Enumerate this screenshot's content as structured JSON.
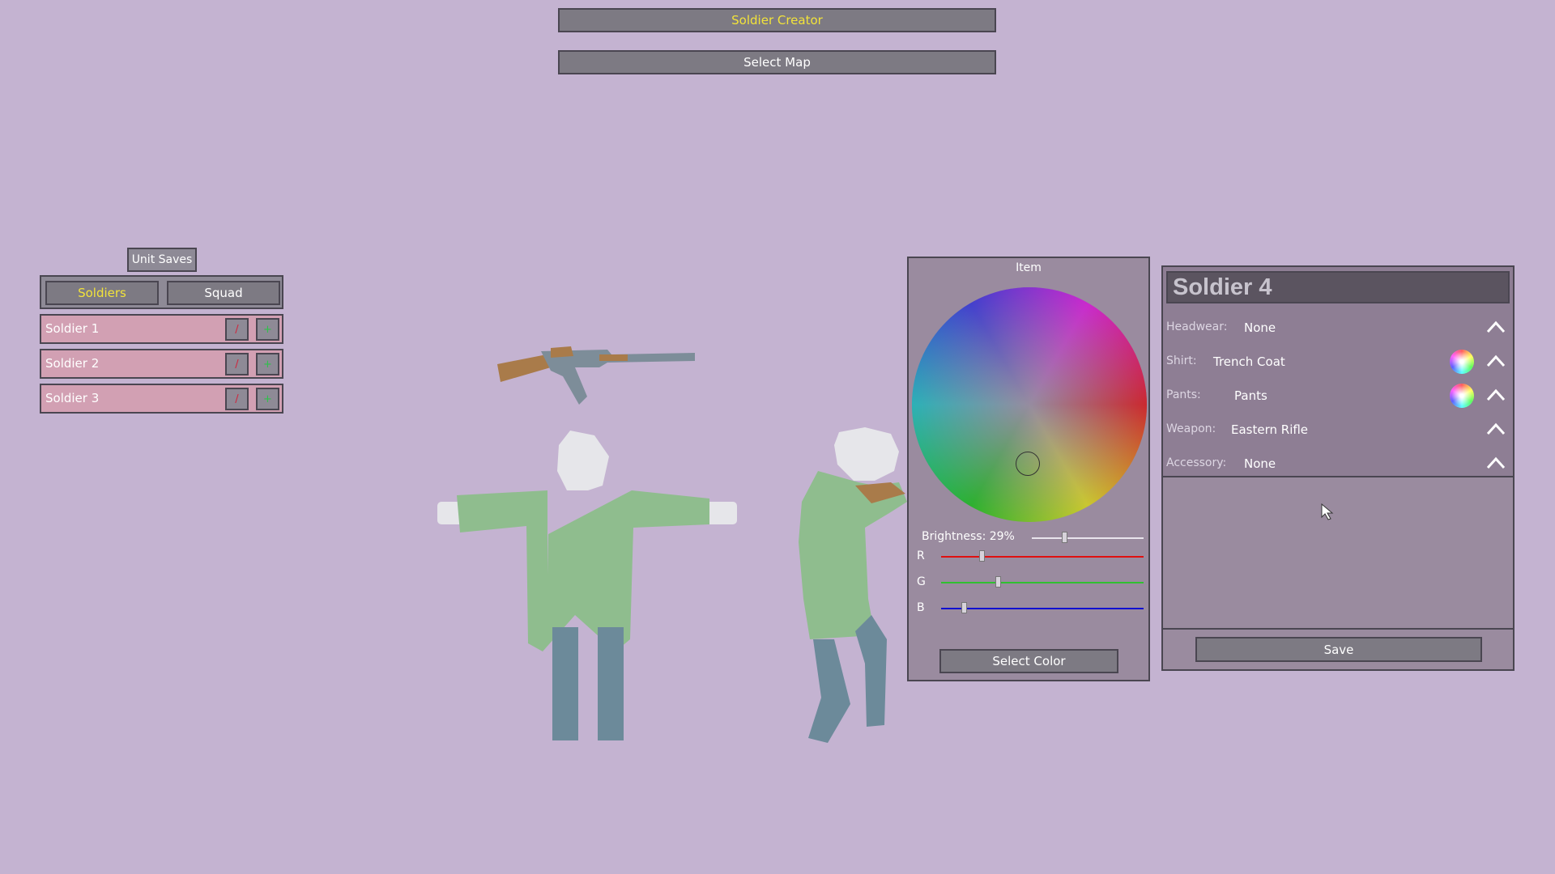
{
  "top_nav": {
    "soldier_creator": "Soldier Creator",
    "select_map": "Select Map"
  },
  "saves": {
    "tab_label": "Unit Saves",
    "tabs": [
      "Soldiers",
      "Squad"
    ],
    "active_tab": "Soldiers",
    "items": [
      {
        "name": "Soldier 1",
        "edit_glyph": "/",
        "add_glyph": "+"
      },
      {
        "name": "Soldier 2",
        "edit_glyph": "/",
        "add_glyph": "+"
      },
      {
        "name": "Soldier 3",
        "edit_glyph": "/",
        "add_glyph": "+"
      }
    ]
  },
  "color_picker": {
    "title": "Item",
    "brightness_label": "Brightness: 29%",
    "brightness": 0.29,
    "channels": [
      {
        "label": "R",
        "value": 0.2,
        "color": "#e01010"
      },
      {
        "label": "G",
        "value": 0.28,
        "color": "#30c030"
      },
      {
        "label": "B",
        "value": 0.11,
        "color": "#1010d0"
      }
    ],
    "select_label": "Select Color"
  },
  "editor": {
    "name": "Soldier 4",
    "attributes": [
      {
        "label": "Headwear:",
        "value": "None",
        "color_swatch": false
      },
      {
        "label": "Shirt:",
        "value": "Trench Coat",
        "color_swatch": true
      },
      {
        "label": "Pants:",
        "value": "Pants",
        "color_swatch": true
      },
      {
        "label": "Weapon:",
        "value": "Eastern Rifle",
        "color_swatch": false
      },
      {
        "label": "Accessory:",
        "value": "None",
        "color_swatch": false
      }
    ],
    "save_label": "Save"
  },
  "colors": {
    "background": "#c4b3d1",
    "shirt": "#8fbd8e",
    "pants": "#6c8a9a",
    "head": "#e6e6ea",
    "active_text": "#f2e33a",
    "save_row": "#d2a0b3"
  },
  "icons": {
    "collapse": "chevron-up-icon",
    "color": "color-wheel-icon",
    "cursor": "mouse-pointer-icon"
  }
}
